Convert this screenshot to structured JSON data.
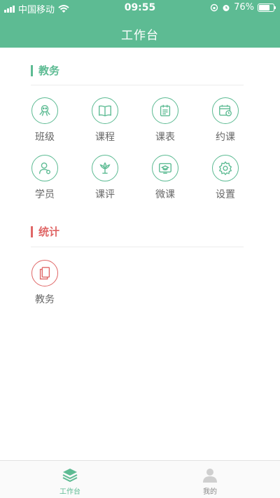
{
  "status_bar": {
    "carrier": "中国移动",
    "time": "09:55",
    "battery": "76%",
    "battery_level": 0.76
  },
  "header": {
    "title": "工作台"
  },
  "sections": [
    {
      "title": "教务",
      "color": "#5dbb93",
      "items": [
        {
          "label": "班级",
          "icon": "octopus-icon"
        },
        {
          "label": "课程",
          "icon": "book-open-icon"
        },
        {
          "label": "课表",
          "icon": "schedule-icon"
        },
        {
          "label": "约课",
          "icon": "calendar-clock-icon"
        },
        {
          "label": "学员",
          "icon": "student-icon"
        },
        {
          "label": "课评",
          "icon": "lotus-icon"
        },
        {
          "label": "微课",
          "icon": "video-course-icon"
        },
        {
          "label": "设置",
          "icon": "gear-icon"
        }
      ]
    },
    {
      "title": "统计",
      "color": "#e06767",
      "items": [
        {
          "label": "教务",
          "icon": "stack-book-icon"
        }
      ]
    }
  ],
  "tabbar": {
    "tabs": [
      {
        "label": "工作台",
        "icon": "layers-icon",
        "active": true
      },
      {
        "label": "我的",
        "icon": "person-icon",
        "active": false
      }
    ]
  },
  "accent_color": "#5dbb93"
}
